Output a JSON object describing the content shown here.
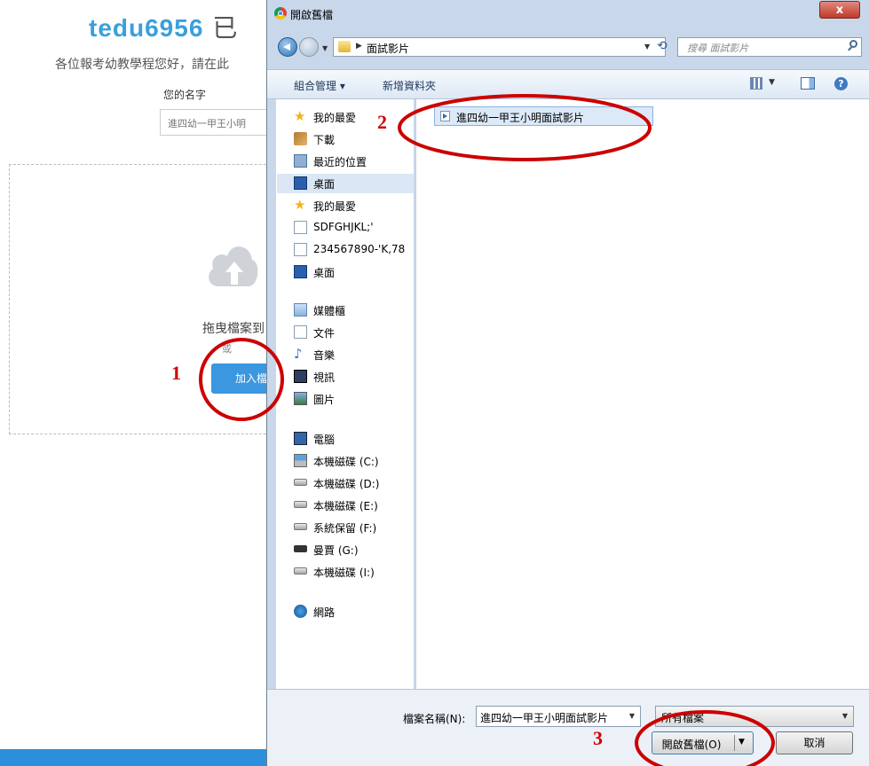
{
  "page": {
    "title": "tedu6956",
    "title_rest": "已",
    "subtitle": "各位報考幼教學程您好，請在此",
    "name_label": "您的名字",
    "name_value": "進四幼一甲王小明",
    "drag_text": "拖曳檔案到",
    "or_text": "或",
    "add_button": "加入檔"
  },
  "dialog": {
    "title": "開啟舊檔",
    "close_label": "x",
    "path": "面試影片",
    "search_placeholder": "搜尋 面試影片",
    "toolbar": {
      "organize": "組合管理 ▾",
      "new_folder": "新增資料夾",
      "help": "?"
    },
    "nav": {
      "favorites": "我的最愛",
      "downloads": "下載",
      "recent": "最近的位置",
      "desktop": "桌面",
      "favorites2": "我的最愛",
      "item1": "SDFGHJKL;'",
      "item2": "234567890-'K,78",
      "desktop2": "桌面",
      "libraries": "媒體櫃",
      "documents": "文件",
      "music": "音樂",
      "videos": "視訊",
      "pictures": "圖片",
      "computer": "電腦",
      "drive_c": "本機磁碟 (C:)",
      "drive_d": "本機磁碟 (D:)",
      "drive_e": "本機磁碟 (E:)",
      "drive_f": "系統保留 (F:)",
      "drive_g": "曼賈 (G:)",
      "drive_i": "本機磁碟 (I:)",
      "network": "網路"
    },
    "files": [
      "進四幼一甲王小明面試影片"
    ],
    "filename_label": "檔案名稱(N):",
    "filename_value": "進四幼一甲王小明面試影片",
    "filetype": "所有檔案",
    "open_button": "開啟舊檔(O)",
    "cancel_button": "取消"
  },
  "annotations": [
    "1",
    "2",
    "3"
  ],
  "colors": {
    "annotation": "#cc0000",
    "brand": "#3aa0dc",
    "button": "#3a97e0"
  }
}
